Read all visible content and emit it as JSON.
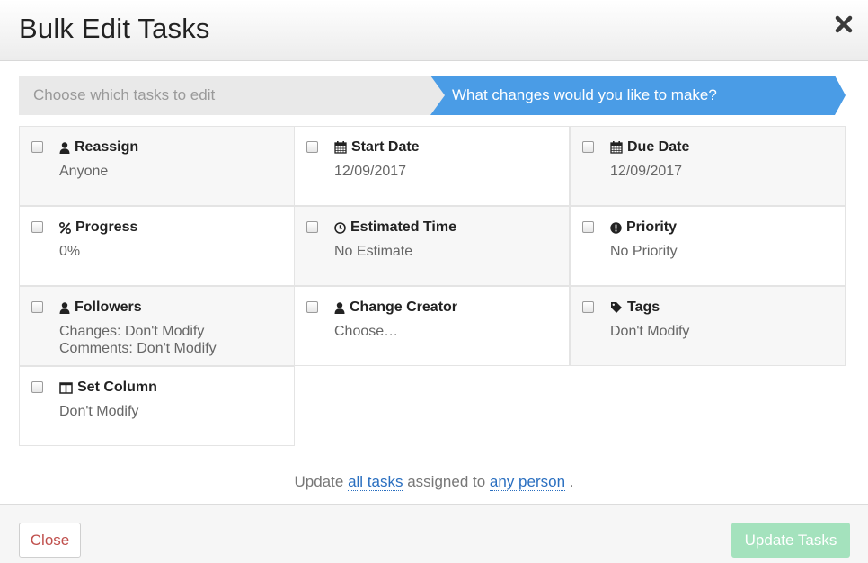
{
  "dialog": {
    "title": "Bulk Edit Tasks"
  },
  "steps": [
    {
      "label": "Choose which tasks to edit",
      "active": false
    },
    {
      "label": "What changes would you like to make?",
      "active": true
    }
  ],
  "fields": [
    {
      "label": "Reassign",
      "icon": "user-icon",
      "value": "Anyone"
    },
    {
      "label": "Start Date",
      "icon": "calendar-icon",
      "value": "12/09/2017"
    },
    {
      "label": "Due Date",
      "icon": "calendar-icon",
      "value": "12/09/2017"
    },
    {
      "label": "Progress",
      "icon": "percent-icon",
      "value": "0%"
    },
    {
      "label": "Estimated Time",
      "icon": "clock-icon",
      "value": "No Estimate"
    },
    {
      "label": "Priority",
      "icon": "exclamation-circle-icon",
      "value": "No Priority"
    },
    {
      "label": "Followers",
      "icon": "user-icon",
      "value": "Changes: Don't Modify",
      "value2": "Comments: Don't Modify"
    },
    {
      "label": "Change Creator",
      "icon": "user-icon",
      "value": "Choose…"
    },
    {
      "label": "Tags",
      "icon": "tag-icon",
      "value": "Don't Modify"
    },
    {
      "label": "Set Column",
      "icon": "columns-icon",
      "value": "Don't Modify"
    }
  ],
  "summary": {
    "prefix": "Update",
    "tasks_link": "all tasks",
    "middle": "assigned to",
    "person_link": "any person",
    "suffix": "."
  },
  "footer": {
    "close_label": "Close",
    "update_label": "Update Tasks"
  },
  "colors": {
    "accent": "#4a9ce6",
    "update_button": "#a4e2bd",
    "close_text": "#c0504d",
    "link": "#2a6fc0"
  }
}
